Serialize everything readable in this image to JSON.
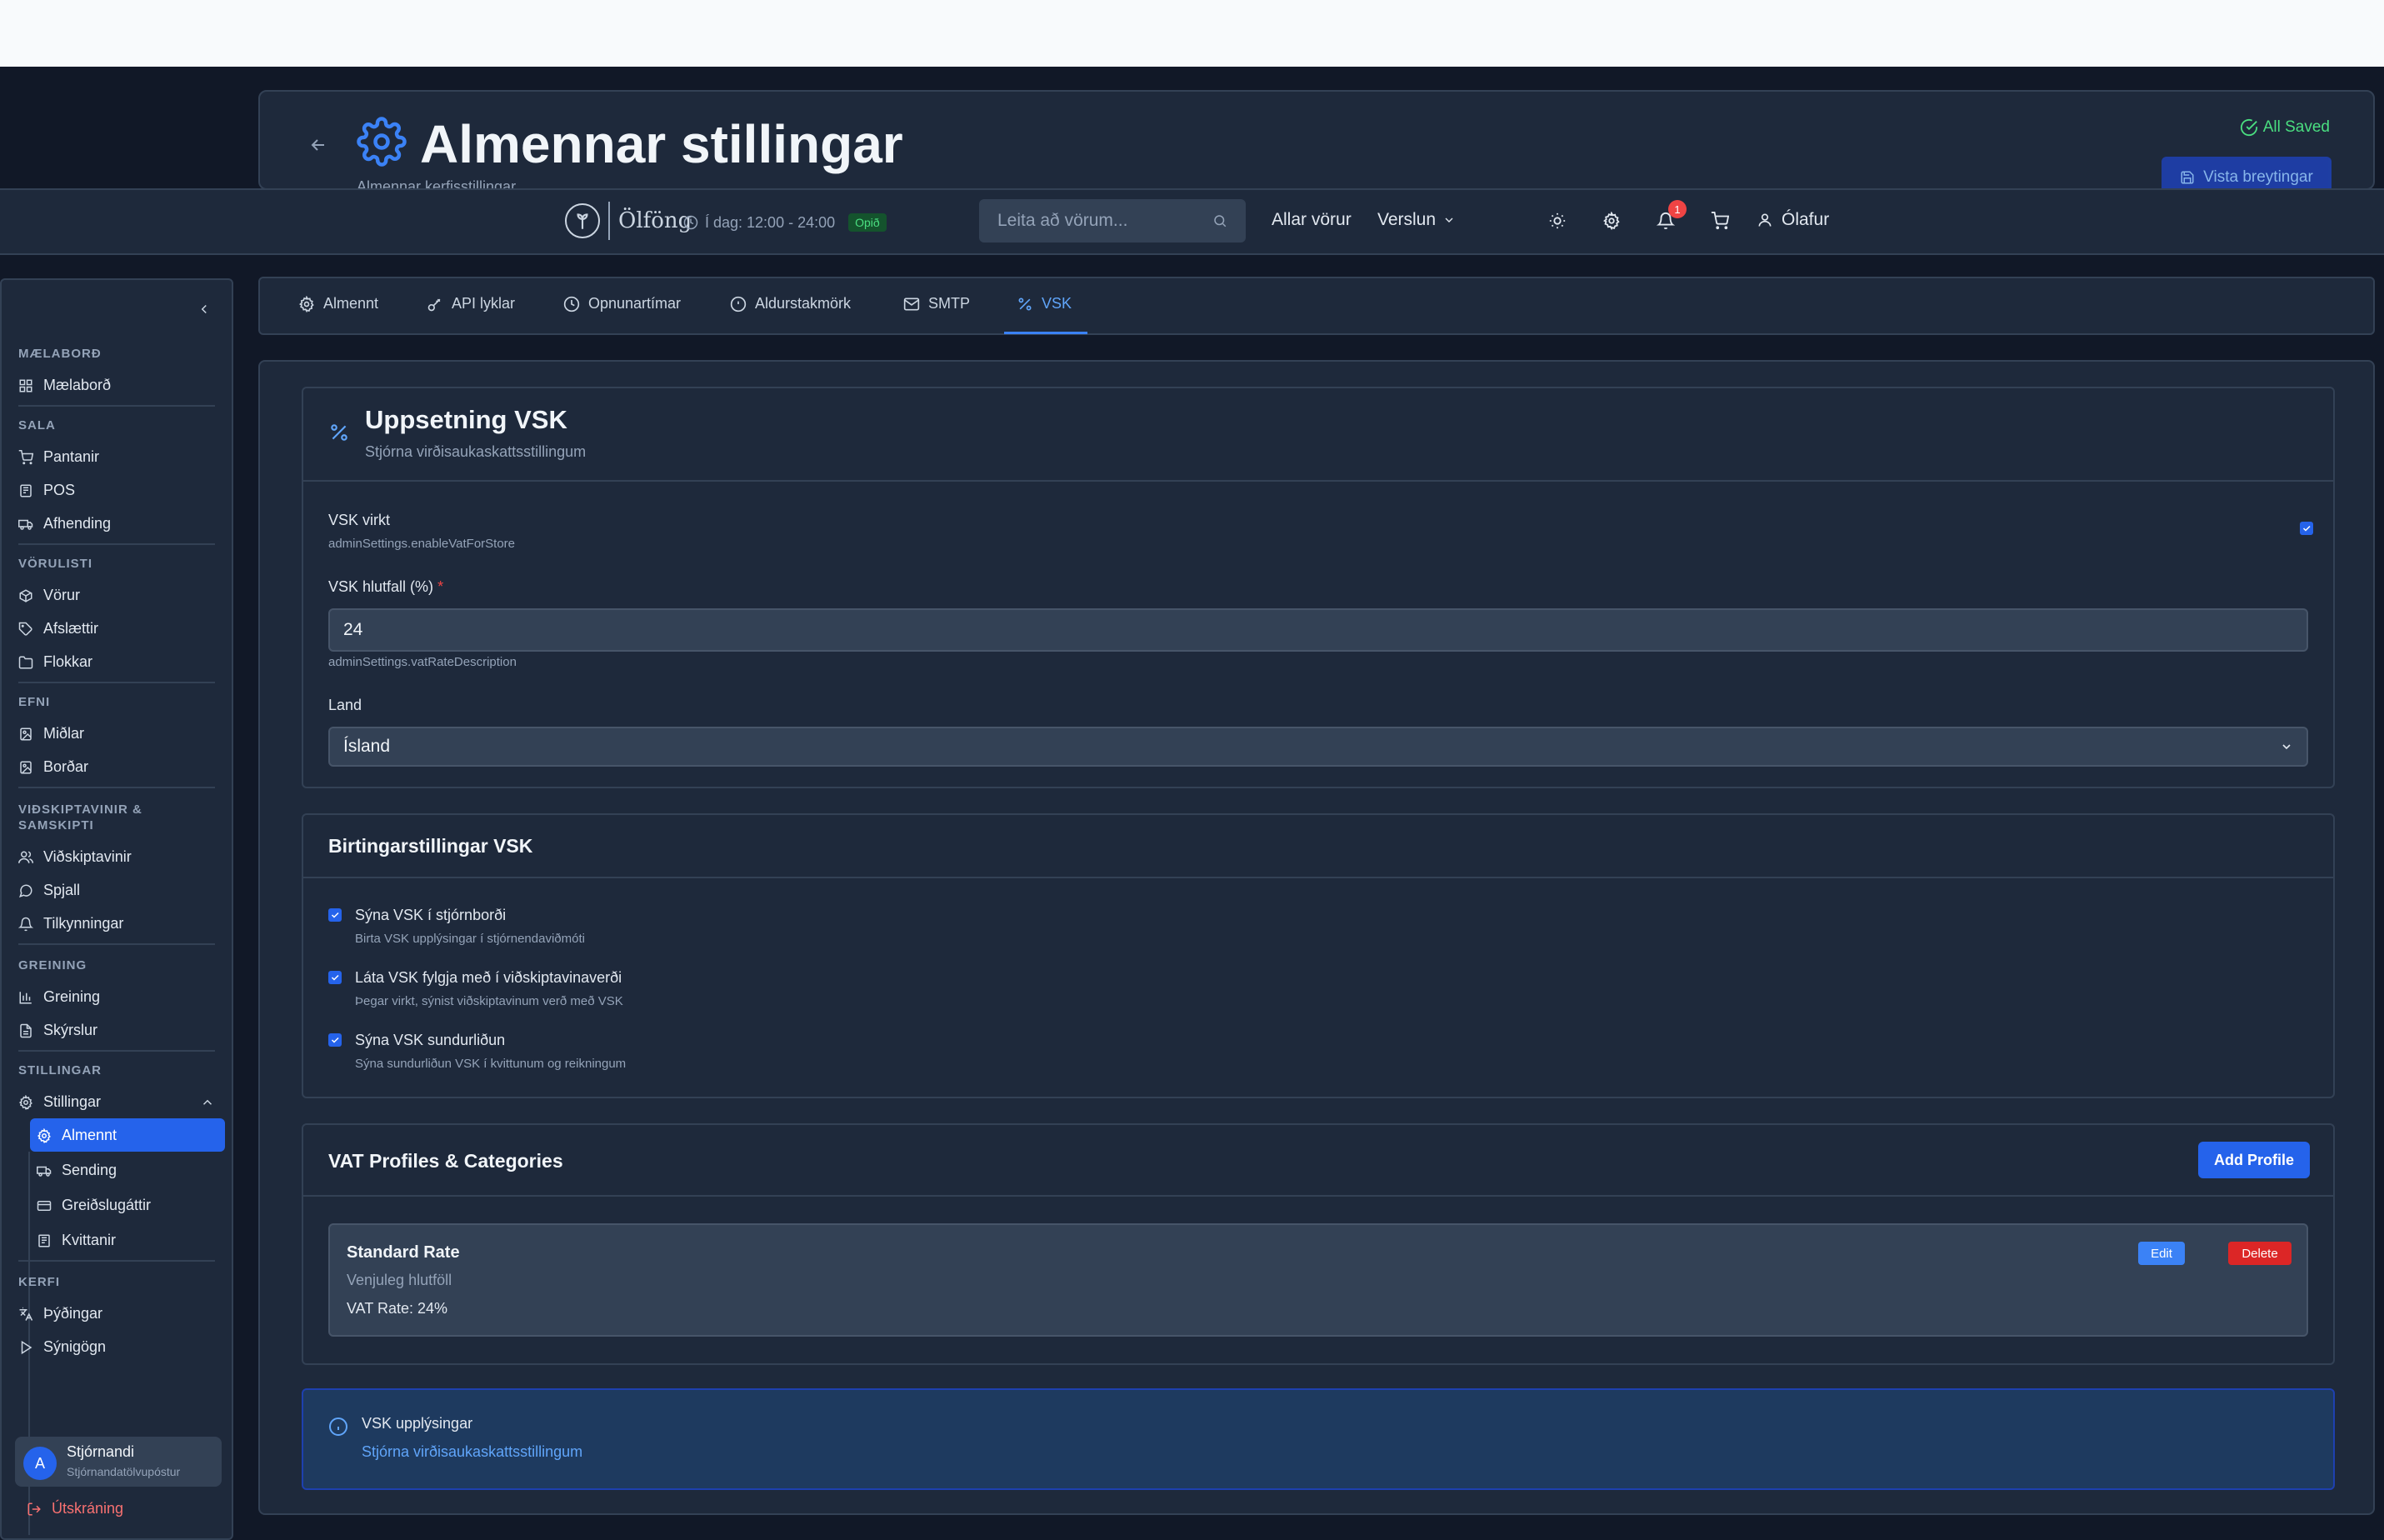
{
  "page_header": {
    "title": "Almennar stillingar",
    "subtitle": "Almennar kerfisstillingar",
    "saved_status": "All Saved",
    "save_button": "Vista breytingar"
  },
  "navbar": {
    "logo_text": "Ölföng",
    "hours": "Í dag: 12:00 - 24:00",
    "open_badge": "Opið",
    "search_placeholder": "Leita að vörum...",
    "links": [
      "Allar vörur",
      "Verslun"
    ],
    "notification_count": "1",
    "user_name": "Ólafur"
  },
  "sidebar": {
    "sections": [
      {
        "title": "MÆLABORÐ",
        "items": [
          "Mælaborð"
        ]
      },
      {
        "title": "SALA",
        "items": [
          "Pantanir",
          "POS",
          "Afhending"
        ]
      },
      {
        "title": "VÖRULISTI",
        "items": [
          "Vörur",
          "Afslættir",
          "Flokkar"
        ]
      },
      {
        "title": "EFNI",
        "items": [
          "Miðlar",
          "Borðar"
        ]
      },
      {
        "title": "VIÐSKIPTAVINIR & SAMSKIPTI",
        "items": [
          "Viðskiptavinir",
          "Spjall",
          "Tilkynningar"
        ]
      },
      {
        "title": "GREINING",
        "items": [
          "Greining",
          "Skýrslur"
        ]
      },
      {
        "title": "STILLINGAR",
        "items": [
          "Stillingar"
        ]
      },
      {
        "title": "KERFI",
        "items": [
          "Þýðingar",
          "Sýnigögn"
        ]
      }
    ],
    "settings_sub": [
      "Almennt",
      "Sending",
      "Greiðslugáttir",
      "Kvittanir"
    ],
    "user": {
      "initial": "A",
      "name": "Stjórnandi",
      "email": "Stjórnandatölvupóstur"
    },
    "logout": "Útskráning"
  },
  "tabs": [
    "Almennt",
    "API lyklar",
    "Opnunartímar",
    "Aldurstakmörk",
    "SMTP",
    "VSK"
  ],
  "active_tab": "VSK",
  "vat_setup": {
    "title": "Uppsetning VSK",
    "description": "Stjórna virðisaukaskattsstillingum",
    "enabled_label": "VSK virkt",
    "enabled_hint": "adminSettings.enableVatForStore",
    "enabled": true,
    "rate_label": "VSK hlutfall (%)",
    "rate_required": "*",
    "rate_value": "24",
    "rate_hint": "adminSettings.vatRateDescription",
    "country_label": "Land",
    "country_value": "Ísland"
  },
  "display_settings": {
    "title": "Birtingarstillingar VSK",
    "options": [
      {
        "label": "Sýna VSK í stjórnborði",
        "hint": "Birta VSK upplýsingar í stjórnendaviðmóti",
        "checked": true
      },
      {
        "label": "Láta VSK fylgja með í viðskiptavinaverði",
        "hint": "Þegar virkt, sýnist viðskiptavinum verð með VSK",
        "checked": true
      },
      {
        "label": "Sýna VSK sundurliðun",
        "hint": "Sýna sundurliðun VSK í kvittunum og reikningum",
        "checked": true
      }
    ]
  },
  "vat_profiles": {
    "title": "VAT Profiles & Categories",
    "add_button": "Add Profile",
    "profiles": [
      {
        "name": "Standard Rate",
        "description": "Venjuleg hlutföll",
        "rate": "VAT Rate: 24%",
        "edit": "Edit",
        "delete": "Delete"
      }
    ]
  },
  "info": {
    "title": "VSK upplýsingar",
    "text": "Stjórna virðisaukaskattsstillingum"
  },
  "colors": {
    "accent": "#2563eb",
    "background": "#111827",
    "panel": "#1e293b",
    "success": "#4ade80",
    "danger": "#dc2626"
  }
}
